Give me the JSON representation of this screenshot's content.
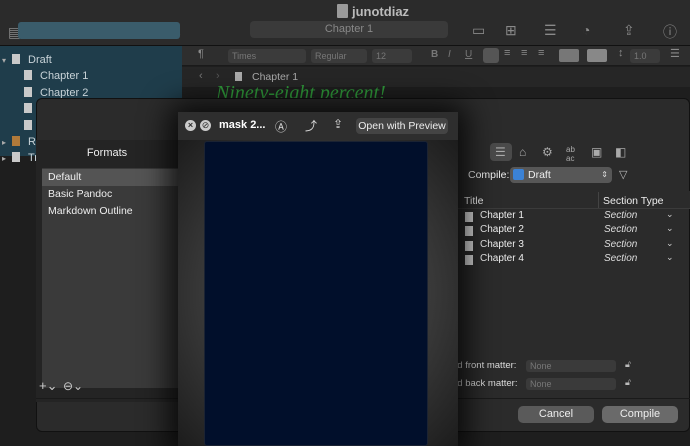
{
  "window": {
    "title": "junotdiaz",
    "path": "Chapter 1"
  },
  "format_bar": {
    "font": "Times",
    "style": "Regular",
    "size": "12",
    "bold": "B",
    "italic": "I",
    "underline": "U",
    "line_spacing": "1.0"
  },
  "binder": {
    "items": [
      {
        "label": "Draft"
      },
      {
        "label": "Chapter 1"
      },
      {
        "label": "Chapter 2"
      },
      {
        "label": "Re"
      },
      {
        "label": "Tr"
      }
    ]
  },
  "editor": {
    "breadcrumb": "Chapter 1",
    "text": "Ninety-eight percent!"
  },
  "compile": {
    "formats_header": "Formats",
    "formats": [
      "Default",
      "Basic Pandoc",
      "Markdown Outline"
    ],
    "compile_label": "Compile:",
    "compile_value": "Draft",
    "columns": {
      "title": "Title",
      "section_type": "Section Type"
    },
    "rows": [
      {
        "title": "Chapter 1",
        "section": "Section"
      },
      {
        "title": "Chapter 2",
        "section": "Section"
      },
      {
        "title": "Chapter 3",
        "section": "Section"
      },
      {
        "title": "Chapter 4",
        "section": "Section"
      }
    ],
    "front_matter_label": "dd front matter:",
    "back_matter_label": "dd back matter:",
    "front_value": "None",
    "back_value": "None",
    "cancel": "Cancel",
    "compile_button": "Compile"
  },
  "quicklook": {
    "title": "mask 2...",
    "open_button": "Open with Preview"
  }
}
